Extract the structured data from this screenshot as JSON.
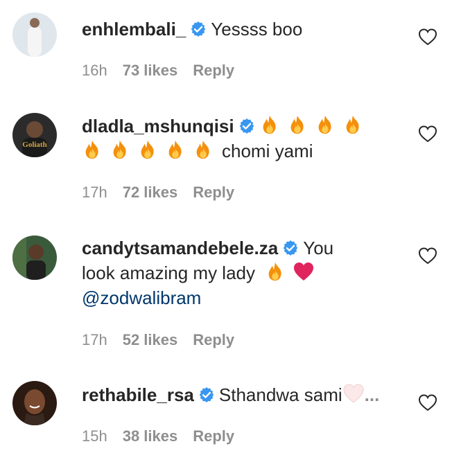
{
  "comments": [
    {
      "username": "enhlembali_",
      "text": "Yessss boo",
      "time": "16h",
      "likes": "73 likes",
      "reply": "Reply",
      "avatar_color": "#dfe6ec"
    },
    {
      "username": "dladla_mshunqisi",
      "text": "chomi yami",
      "avatar_text": "Goliath",
      "time": "17h",
      "likes": "72 likes",
      "reply": "Reply",
      "avatar_color": "#2b2b2b"
    },
    {
      "username": "candytsamandebele.za",
      "text_part1": "You",
      "text_part2": "look amazing my lady",
      "mention": "@zodwalibram",
      "time": "17h",
      "likes": "52 likes",
      "reply": "Reply",
      "avatar_color": "#3a5a3c"
    },
    {
      "username": "rethabile_rsa",
      "text": "Sthandwa sami",
      "ellipsis": "...",
      "time": "15h",
      "likes": "38 likes",
      "reply": "Reply",
      "avatar_color": "#5a3a28"
    }
  ],
  "colors": {
    "verified": "#3897f0",
    "mention": "#00376b",
    "meta": "#8e8e8e",
    "heart_red": "#e0245e"
  },
  "icons": {
    "verified": "verified-badge-icon",
    "fire": "fire-emoji",
    "heart_outline": "heart-outline-icon",
    "red_heart": "red-heart-emoji",
    "pink_heart": "white-heart-emoji"
  }
}
